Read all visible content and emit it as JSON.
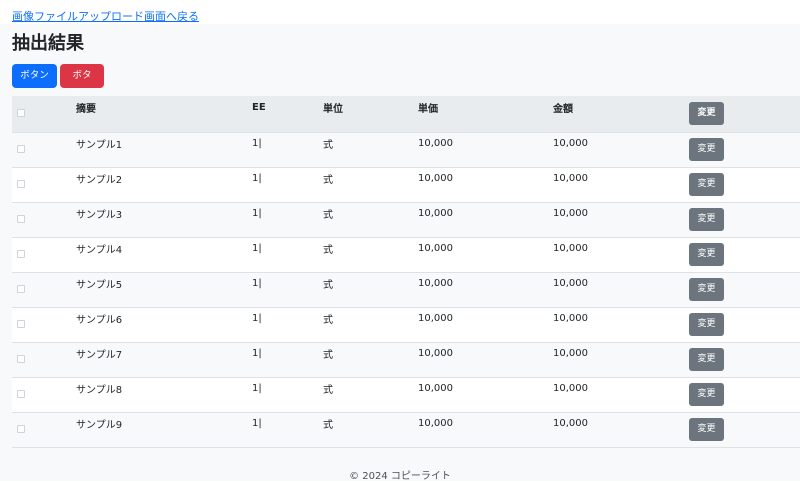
{
  "nav": {
    "back_link": "画像ファイルアップロード画面へ戻る"
  },
  "page": {
    "title": "抽出結果"
  },
  "buttons": {
    "primary": "ボタン",
    "danger": "ボタン"
  },
  "table": {
    "headers": {
      "summary": "摘要",
      "qty": "EE",
      "unit": "単位",
      "unit_price": "単価",
      "amount": "金額",
      "action": "変更"
    },
    "rows": [
      {
        "summary": "サンプル1",
        "qty": "1|",
        "unit": "式",
        "unit_price": "10,000",
        "amount": "10,000",
        "action": "変更"
      },
      {
        "summary": "サンプル2",
        "qty": "1|",
        "unit": "式",
        "unit_price": "10,000",
        "amount": "10,000",
        "action": "変更"
      },
      {
        "summary": "サンプル3",
        "qty": "1|",
        "unit": "式",
        "unit_price": "10,000",
        "amount": "10,000",
        "action": "変更"
      },
      {
        "summary": "サンプル4",
        "qty": "1|",
        "unit": "式",
        "unit_price": "10,000",
        "amount": "10,000",
        "action": "変更"
      },
      {
        "summary": "サンプル5",
        "qty": "1|",
        "unit": "式",
        "unit_price": "10,000",
        "amount": "10,000",
        "action": "変更"
      },
      {
        "summary": "サンプル6",
        "qty": "1|",
        "unit": "式",
        "unit_price": "10,000",
        "amount": "10,000",
        "action": "変更"
      },
      {
        "summary": "サンプル7",
        "qty": "1|",
        "unit": "式",
        "unit_price": "10,000",
        "amount": "10,000",
        "action": "変更"
      },
      {
        "summary": "サンプル8",
        "qty": "1|",
        "unit": "式",
        "unit_price": "10,000",
        "amount": "10,000",
        "action": "変更"
      },
      {
        "summary": "サンプル9",
        "qty": "1|",
        "unit": "式",
        "unit_price": "10,000",
        "amount": "10,000",
        "action": "変更"
      }
    ]
  },
  "footer": {
    "text": "© 2024 コピーライト"
  },
  "colors": {
    "primary": "#0d6efd",
    "danger": "#dc3545",
    "secondary": "#6c757d",
    "background": "#f8f9fa"
  }
}
